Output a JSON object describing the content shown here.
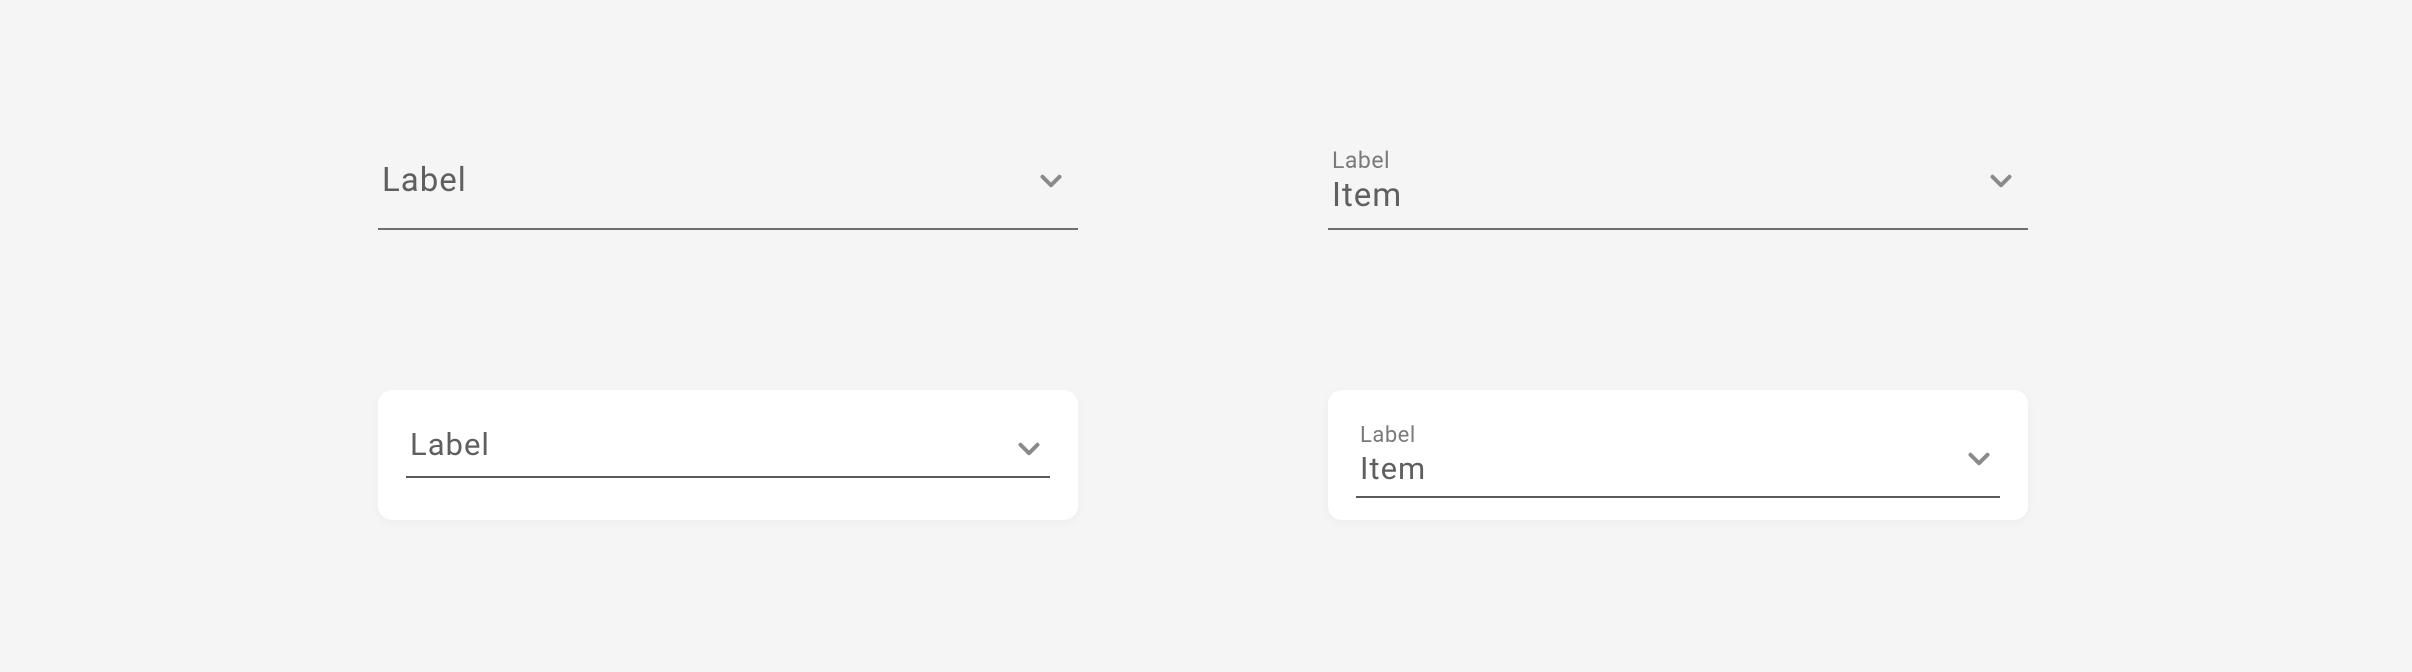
{
  "selects": {
    "top_left": {
      "label": "Label",
      "value": ""
    },
    "top_right": {
      "label": "Label",
      "value": "Item"
    },
    "bottom_left": {
      "label": "Label",
      "value": ""
    },
    "bottom_right": {
      "label": "Label",
      "value": "Item"
    }
  }
}
